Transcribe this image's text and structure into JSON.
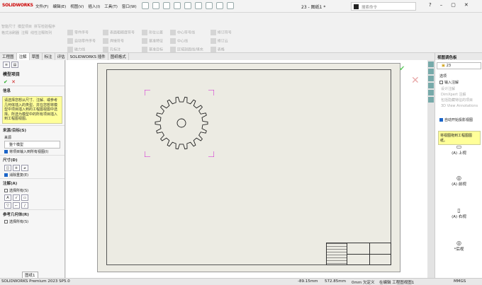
{
  "app": {
    "logo": "SOLIDWORKS",
    "doc_title": "23 - 图纸1 *",
    "search_placeholder": "搜索命令"
  },
  "menus": [
    "文件(F)",
    "编辑(E)",
    "视图(V)",
    "插入(I)",
    "工具(T)",
    "窗口(W)"
  ],
  "ribbon": {
    "left_labels": [
      "智能尺寸",
      "模型项目",
      "拼写检验程序",
      "格式涂刷器",
      "注释",
      "线性注释阵列"
    ],
    "items": [
      "零件序号",
      "自动零件序号",
      "磁力线",
      "表面粗糙度符号",
      "焊接符号",
      "孔标注",
      "形位公差",
      "基准特征",
      "基准目标",
      "中心符号线",
      "中心线",
      "区域剖面线/填充",
      "修订符号",
      "修订云",
      "表格"
    ]
  },
  "tabs": [
    "工程图",
    "注解",
    "草图",
    "标注",
    "评估",
    "SOLIDWORKS 插件",
    "图纸格式"
  ],
  "left_panel": {
    "title": "模型项目",
    "info_header": "信息",
    "info_text": "请选择您想从尺寸、注解、或参考几何体插入的类型。并在您想将模型中项目插入到的工程图视图中选择。所选为模型中的所有项目插入到工程图视图。",
    "source_header": "来源/目标(S)",
    "source_label": "来源",
    "source_value": "整个模型",
    "source_checkbox": "将项目输入到所有视图(I)",
    "dims_header": "尺寸(D)",
    "dims_checkbox": "消除重复(E)",
    "notes_header": "注解(A)",
    "notes_selectall": "选择所有(S)",
    "ref_header": "参考几何体(R)",
    "ref_selectall": "选择所有(S)"
  },
  "right_panel": {
    "title": "视图调色板",
    "part": "23",
    "options_label": "选项",
    "import_notes": "输入注解",
    "sub_options": [
      "设计注解",
      "DimXpert 注解",
      "包括隐藏特征的项目",
      "3D View Annotations"
    ],
    "auto_start": "自动开始投影视图",
    "hint": "将视图拖到工程图图纸。",
    "views": [
      "(A) 上视",
      "(A) 前视",
      "(A) 右视",
      "*后视"
    ]
  },
  "sheet_tab": "图纸1",
  "status": {
    "app": "SOLIDWORKS Premium 2023 SP5.0",
    "x": "-89.15mm",
    "y": "572.85mm",
    "z": "0mm 欠定义",
    "mode": "在编辑 工程图视图1",
    "units": "MMGS"
  }
}
